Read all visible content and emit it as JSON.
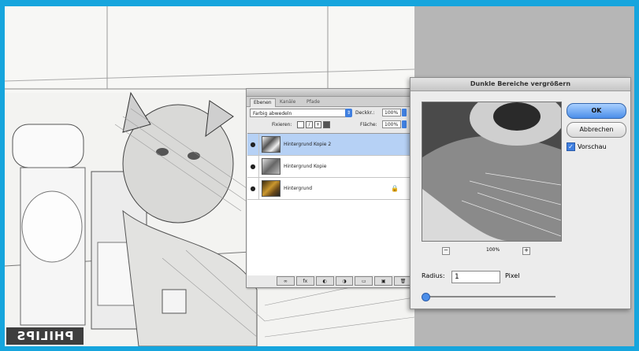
{
  "canvas": {
    "brand_text": "PHILIPS"
  },
  "layers_panel": {
    "tabs": [
      "Ebenen",
      "Kanäle",
      "Pfade"
    ],
    "blend_mode": "Farbig abwedeln",
    "opacity_label": "Deckkr.:",
    "opacity_value": "100%",
    "lock_label": "Fixieren:",
    "fill_label": "Fläche:",
    "fill_value": "100%",
    "layers": [
      {
        "name": "Hintergrund Kopie 2",
        "selected": true
      },
      {
        "name": "Hintergrund Kopie",
        "selected": false
      },
      {
        "name": "Hintergrund",
        "selected": false
      }
    ],
    "bottom_buttons": [
      "∞",
      "fx",
      "◐",
      "◑",
      "▭",
      "▣",
      "🗑"
    ]
  },
  "dialog": {
    "title": "Dunkle Bereiche vergrößern",
    "ok_label": "OK",
    "cancel_label": "Abbrechen",
    "preview_label": "Vorschau",
    "zoom_out": "−",
    "zoom_in": "+",
    "zoom_value": "100%",
    "radius_label": "Radius:",
    "radius_value": "1",
    "unit_label": "Pixel",
    "preview_checked": true,
    "slider_level": 0.0
  }
}
